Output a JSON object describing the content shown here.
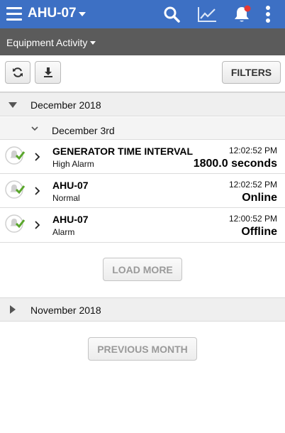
{
  "header": {
    "title": "AHU-07",
    "icons": [
      "menu-icon",
      "search-icon",
      "chart-icon",
      "bell-icon",
      "more-icon"
    ],
    "colors": {
      "bar": "#3d70c4",
      "bell_badge": "#e53935"
    }
  },
  "subheader": {
    "label": "Equipment Activity",
    "color": "#5b5b5b"
  },
  "toolbar": {
    "filters_label": "FILTERS"
  },
  "months": [
    {
      "label": "December 2018",
      "expanded": true
    },
    {
      "label": "November 2018",
      "expanded": false
    }
  ],
  "day": {
    "label": "December 3rd"
  },
  "events": [
    {
      "name": "GENERATOR TIME INTERVAL",
      "type": "High Alarm",
      "time": "12:02:52 PM",
      "value": "1800.0 seconds"
    },
    {
      "name": "AHU-07",
      "type": "Normal",
      "time": "12:02:52 PM",
      "value": "Online"
    },
    {
      "name": "AHU-07",
      "type": "Alarm",
      "time": "12:00:52 PM",
      "value": "Offline"
    }
  ],
  "status_check_color": "#5aa62c",
  "buttons": {
    "load_more": "LOAD MORE",
    "previous_month": "PREVIOUS MONTH"
  }
}
